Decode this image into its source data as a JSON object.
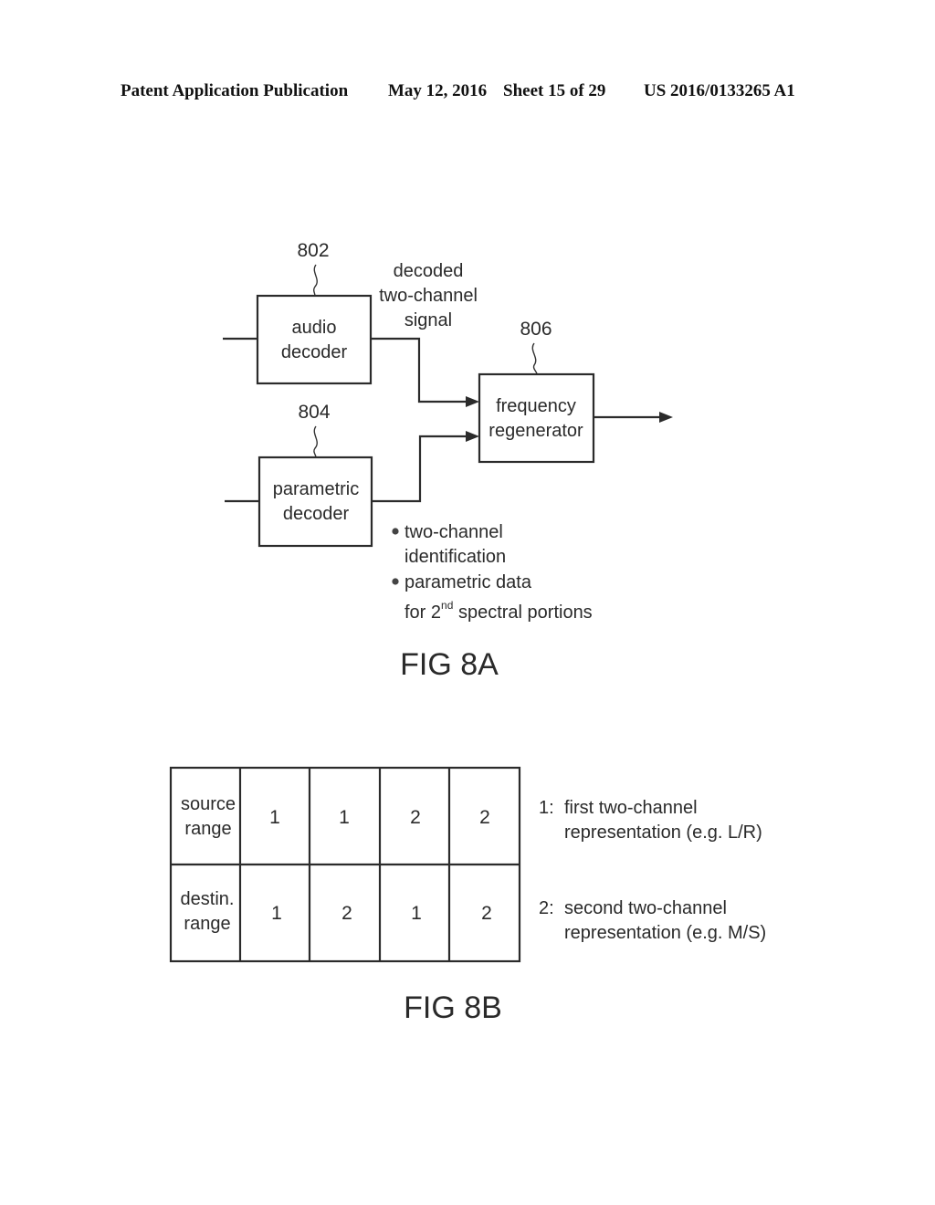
{
  "header": {
    "publication": "Patent Application Publication",
    "date": "May 12, 2016",
    "sheet": "Sheet 15 of 29",
    "number": "US 2016/0133265 A1"
  },
  "fig8a": {
    "caption": "FIG 8A",
    "blocks": [
      {
        "ref": "802",
        "line1": "audio",
        "line2": "decoder"
      },
      {
        "ref": "804",
        "line1": "parametric",
        "line2": "decoder"
      },
      {
        "ref": "806",
        "line1": "frequency",
        "line2": "regenerator"
      }
    ],
    "signal_label": [
      "decoded",
      "two-channel",
      "signal"
    ],
    "bullets": [
      {
        "lines": [
          "two-channel",
          "identification"
        ]
      },
      {
        "lines": [
          "parametric data",
          "for 2",
          "nd",
          " spectral portions"
        ]
      }
    ]
  },
  "fig8b": {
    "caption": "FIG 8B",
    "table": {
      "rows": [
        {
          "header": [
            "source",
            "range"
          ],
          "cells": [
            "1",
            "1",
            "2",
            "2"
          ]
        },
        {
          "header": [
            "destin.",
            "range"
          ],
          "cells": [
            "1",
            "2",
            "1",
            "2"
          ]
        }
      ]
    },
    "legend": [
      {
        "key": "1:",
        "lines": [
          "first two-channel",
          "representation (e.g. L/R)"
        ]
      },
      {
        "key": "2:",
        "lines": [
          "second two-channel",
          "representation (e.g. M/S)"
        ]
      }
    ]
  }
}
